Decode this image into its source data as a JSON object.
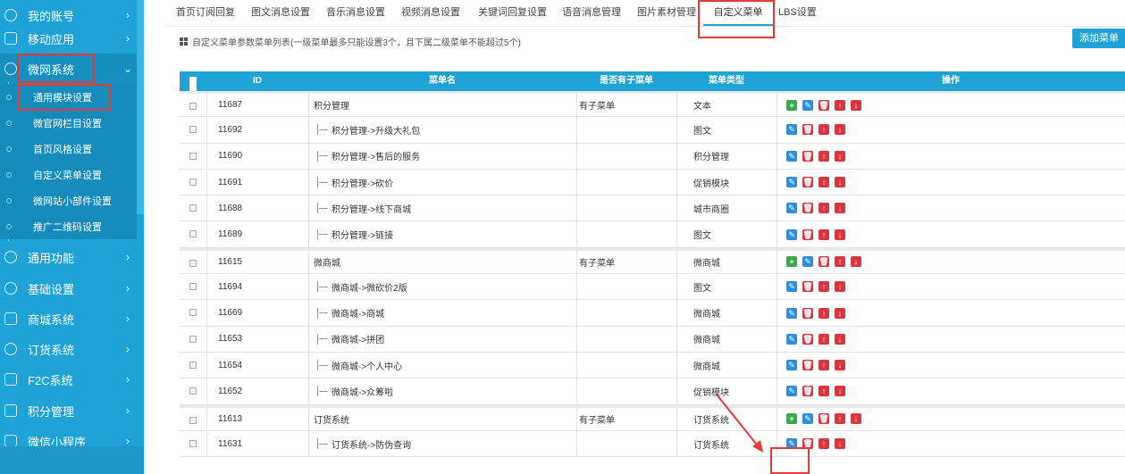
{
  "sidebar": {
    "items": [
      {
        "label": "我的账号",
        "icon": "user-icon"
      },
      {
        "label": "移动应用",
        "icon": "apps-icon"
      },
      {
        "label": "微网系统",
        "icon": "globe-icon"
      },
      {
        "label": "通用功能",
        "icon": "play-circle-icon"
      },
      {
        "label": "基础设置",
        "icon": "globe-icon"
      },
      {
        "label": "商城系统",
        "icon": "cart-icon"
      },
      {
        "label": "订货系统",
        "icon": "cluster-icon"
      },
      {
        "label": "F2C系统",
        "icon": "cart-icon"
      },
      {
        "label": "积分管理",
        "icon": "cart-icon"
      },
      {
        "label": "微信小程序",
        "icon": "cart-icon"
      }
    ],
    "subitems": [
      "通用模块设置",
      "微官网栏目设置",
      "首页风格设置",
      "自定义菜单设置",
      "微网站小部件设置",
      "推广二维码设置"
    ]
  },
  "tabs": [
    "首页订阅回复",
    "图文消息设置",
    "音乐消息设置",
    "视频消息设置",
    "关键词回复设置",
    "语音消息管理",
    "图片素材管理",
    "自定义菜单",
    "LBS设置"
  ],
  "active_tab": "自定义菜单",
  "info_text": "自定义菜单参数菜单列表(一级菜单最多只能设置3个，且下属二级菜单不能超过5个)",
  "add_button": "添加菜单",
  "table": {
    "headers": {
      "id": "ID",
      "name": "菜单名",
      "has_sub": "是否有子菜单",
      "type": "菜单类型",
      "ops": "操作"
    },
    "rows": [
      {
        "id": "11687",
        "name": "积分管理",
        "child": false,
        "has_sub": "有子菜单",
        "type": "文本"
      },
      {
        "id": "11692",
        "name": "积分管理->升级大礼包",
        "child": true,
        "has_sub": "",
        "type": "图文"
      },
      {
        "id": "11690",
        "name": "积分管理->售后的服务",
        "child": true,
        "has_sub": "",
        "type": "积分管理"
      },
      {
        "id": "11691",
        "name": "积分管理->砍价",
        "child": true,
        "has_sub": "",
        "type": "促销模块"
      },
      {
        "id": "11688",
        "name": "积分管理->线下商城",
        "child": true,
        "has_sub": "",
        "type": "城市商圈"
      },
      {
        "id": "11689",
        "name": "积分管理->链接",
        "child": true,
        "has_sub": "",
        "type": "图文"
      },
      {
        "id": "11615",
        "name": "微商城",
        "child": false,
        "has_sub": "有子菜单",
        "type": "微商城"
      },
      {
        "id": "11694",
        "name": "微商城->微砍价2版",
        "child": true,
        "has_sub": "",
        "type": "图文"
      },
      {
        "id": "11669",
        "name": "微商城->商城",
        "child": true,
        "has_sub": "",
        "type": "微商城"
      },
      {
        "id": "11653",
        "name": "微商城->拼团",
        "child": true,
        "has_sub": "",
        "type": "微商城"
      },
      {
        "id": "11654",
        "name": "微商城->个人中心",
        "child": true,
        "has_sub": "",
        "type": "微商城"
      },
      {
        "id": "11652",
        "name": "微商城->众筹啦",
        "child": true,
        "has_sub": "",
        "type": "促销模块"
      },
      {
        "id": "11613",
        "name": "订货系统",
        "child": false,
        "has_sub": "有子菜单",
        "type": "订货系统"
      },
      {
        "id": "11631",
        "name": "订货系统->防伪查询",
        "child": true,
        "has_sub": "",
        "type": "订货系统"
      }
    ]
  },
  "colors": {
    "accent": "#1fa3d6",
    "sidebar": "#1fa3d6",
    "highlight": "#e53935"
  }
}
